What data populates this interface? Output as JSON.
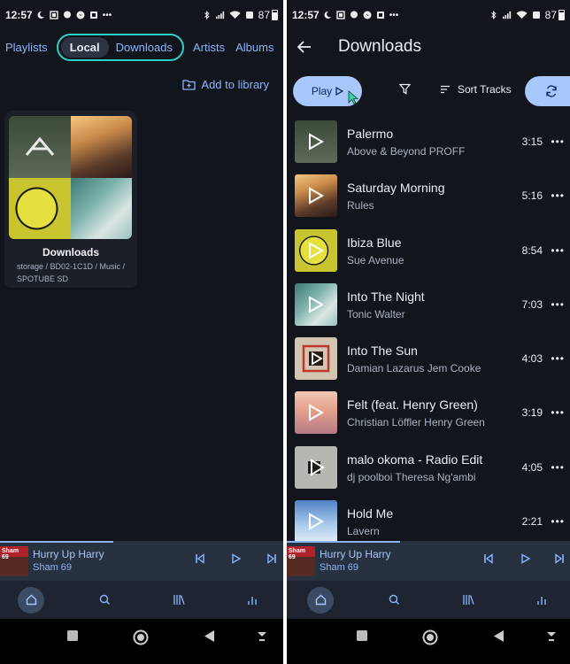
{
  "status": {
    "time": "12:57",
    "battery": "87"
  },
  "left": {
    "tabs": [
      "Playlists",
      "Local",
      "Downloads",
      "Artists",
      "Albums"
    ],
    "add_library_label": "Add to library",
    "folder": {
      "title": "Downloads",
      "path": "storage / BD02-1C1D / Music / SPOTUBE SD"
    }
  },
  "right": {
    "title": "Downloads",
    "play_label": "Play",
    "sort_label": "Sort Tracks",
    "tracks": [
      {
        "name": "Palermo",
        "artist": "Above & Beyond  PROFF",
        "duration": "3:15"
      },
      {
        "name": "Saturday Morning",
        "artist": "Rules",
        "duration": "5:16"
      },
      {
        "name": "Ibiza Blue",
        "artist": "Sue Avenue",
        "duration": "8:54"
      },
      {
        "name": "Into The Night",
        "artist": "Tonic Walter",
        "duration": "7:03"
      },
      {
        "name": "Into The Sun",
        "artist": "Damian Lazarus  Jem Cooke",
        "duration": "4:03"
      },
      {
        "name": "Felt (feat. Henry Green)",
        "artist": "Christian Löffler  Henry Green",
        "duration": "3:19"
      },
      {
        "name": "malo okoma - Radio Edit",
        "artist": "dj poolboi  Theresa Ng'ambi",
        "duration": "4:05"
      },
      {
        "name": "Hold Me",
        "artist": "Lavern",
        "duration": "2:21"
      }
    ]
  },
  "player": {
    "title": "Hurry Up Harry",
    "artist": "Sham 69",
    "cover_text": "Sham 69"
  },
  "more_label": "•••",
  "colors": {
    "accent": "#8ab4ff",
    "accent_fill": "#a8c7fa",
    "highlight_outline": "#2ad0c7",
    "background": "#12151c"
  }
}
